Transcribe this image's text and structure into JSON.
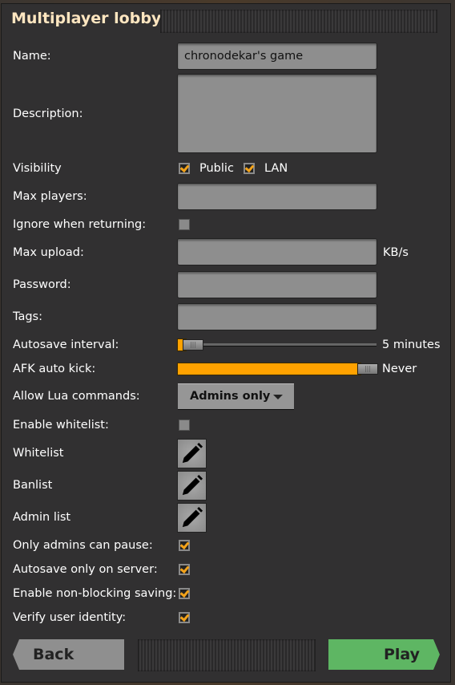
{
  "title": "Multiplayer lobby",
  "fields": {
    "name": {
      "label": "Name:",
      "value": "chronodekar's game"
    },
    "description": {
      "label": "Description:",
      "value": ""
    },
    "visibility": {
      "label": "Visibility",
      "public": "Public",
      "public_checked": true,
      "lan": "LAN",
      "lan_checked": true
    },
    "max_players": {
      "label": "Max players:",
      "value": ""
    },
    "ignore_returning": {
      "label": "Ignore when returning:",
      "checked": false
    },
    "max_upload": {
      "label": "Max upload:",
      "value": "",
      "unit": "KB/s"
    },
    "password": {
      "label": "Password:",
      "value": ""
    },
    "tags": {
      "label": "Tags:",
      "value": ""
    },
    "autosave_interval": {
      "label": "Autosave interval:",
      "value_text": "5 minutes",
      "fraction": 0.02
    },
    "afk_auto_kick": {
      "label": "AFK auto kick:",
      "value_text": "Never",
      "fraction": 1.0
    },
    "allow_lua": {
      "label": "Allow Lua commands:",
      "selected": "Admins only"
    },
    "enable_whitelist": {
      "label": "Enable whitelist:",
      "checked": false
    },
    "whitelist": {
      "label": "Whitelist"
    },
    "banlist": {
      "label": "Banlist"
    },
    "admin_list": {
      "label": "Admin list"
    },
    "only_admins_pause": {
      "label": "Only admins can pause:",
      "checked": true
    },
    "autosave_only_server": {
      "label": "Autosave only on server:",
      "checked": true
    },
    "non_blocking_saving": {
      "label": "Enable non-blocking saving:",
      "checked": true
    },
    "verify_identity": {
      "label": "Verify user identity:",
      "checked": true
    }
  },
  "footer": {
    "back": "Back",
    "play": "Play"
  },
  "colors": {
    "accent": "#ffa200",
    "play": "#5eb663",
    "title": "#ffe6c0"
  }
}
